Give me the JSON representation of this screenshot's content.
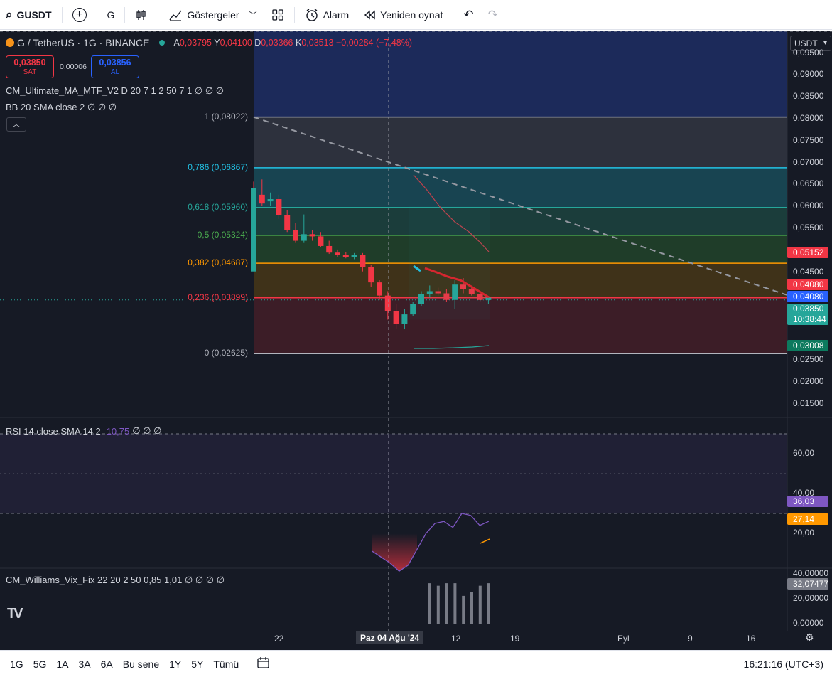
{
  "toolbar": {
    "symbol": "GUSDT",
    "add_symbol": "+",
    "interval": "G",
    "indicators_label": "Göstergeler",
    "alarm_label": "Alarm",
    "replay_label": "Yeniden oynat"
  },
  "legend": {
    "title": "G / TetherUS · 1G · BINANCE",
    "o_label": "A",
    "o_value": "0,03795",
    "h_label": "Y",
    "h_value": "0,04100",
    "l_label": "D",
    "l_value": "0,03366",
    "c_label": "K",
    "c_value": "0,03513",
    "change": "−0,00284 (−7,48%)",
    "sell_value": "0,03850",
    "sell_label": "SAT",
    "spread": "0,00006",
    "buy_value": "0,03856",
    "buy_label": "AL",
    "indicator1": "CM_Ultimate_MA_MTF_V2 D 20 7 1 2 50 7 1  ∅ ∅ ∅",
    "indicator2": "BB 20 SMA close 2  ∅ ∅ ∅",
    "rsi_label": "RSI 14 close SMA 14 2",
    "rsi_value": "10,75",
    "rsi_tail": "∅ ∅ ∅",
    "vix_label": "CM_Williams_Vix_Fix 22 20 2 50 0,85 1,01  ∅ ∅ ∅ ∅"
  },
  "price_axis": {
    "currency": "USDT",
    "ticks": [
      "0,09500",
      "0,09000",
      "0,08500",
      "0,08000",
      "0,07500",
      "0,07000",
      "0,06500",
      "0,06000",
      "0,05500",
      "0,04500",
      "0,02500",
      "0,02000",
      "0,01500"
    ],
    "tags": {
      "ma_red": "0,05152",
      "fib_level": "0,04080",
      "blue": "0,04080",
      "last": "0,03850",
      "countdown": "10:38:44",
      "low": "0,03008"
    }
  },
  "fib_levels": [
    {
      "label": "1 (0,08022)",
      "color": "#b2b5be"
    },
    {
      "label": "0,786 (0,06867)",
      "color": "#22c3e6"
    },
    {
      "label": "0,618 (0,05960)",
      "color": "#26a69a"
    },
    {
      "label": "0,5 (0,05324)",
      "color": "#4caf50"
    },
    {
      "label": "0,382 (0,04687)",
      "color": "#ff9800"
    },
    {
      "label": "0,236 (0,03899)",
      "color": "#f23645"
    },
    {
      "label": "0 (0,02625)",
      "color": "#b2b5be"
    }
  ],
  "rsi_axis": {
    "ticks": [
      "60,00",
      "40,00",
      "20,00"
    ],
    "tag_rsi": "36,03",
    "tag_sma": "27,14"
  },
  "vix_axis": {
    "ticks": [
      "40,00000",
      "20,00000",
      "0,00000"
    ],
    "tag": "32,07477"
  },
  "time_axis": {
    "labels": [
      "22",
      "Paz 04 Ağu '24",
      "12",
      "19",
      "Eyl",
      "9",
      "16"
    ]
  },
  "bottombar": {
    "ranges": [
      "1G",
      "5G",
      "1A",
      "3A",
      "6A",
      "Bu sene",
      "1Y",
      "5Y",
      "Tümü"
    ],
    "clock": "16:21:16 (UTC+3)"
  },
  "chart_data": {
    "type": "candlestick",
    "series": [
      {
        "values": [
          [
            0.064,
            0.0655,
            0.062,
            0.0625
          ],
          [
            0.0625,
            0.066,
            0.06,
            0.0605
          ],
          [
            0.061,
            0.063,
            0.06,
            0.0615
          ],
          [
            0.0615,
            0.0625,
            0.057,
            0.0578
          ],
          [
            0.0578,
            0.059,
            0.054,
            0.0545
          ],
          [
            0.0545,
            0.056,
            0.0515,
            0.052
          ],
          [
            0.052,
            0.058,
            0.0515,
            0.0535
          ],
          [
            0.0535,
            0.0545,
            0.052,
            0.053
          ],
          [
            0.053,
            0.054,
            0.0505,
            0.0508
          ],
          [
            0.0508,
            0.052,
            0.049,
            0.0493
          ],
          [
            0.0493,
            0.05,
            0.0483,
            0.0487
          ],
          [
            0.0487,
            0.0495,
            0.048,
            0.0482
          ],
          [
            0.0482,
            0.0492,
            0.0478,
            0.0488
          ],
          [
            0.0488,
            0.0492,
            0.045,
            0.046
          ],
          [
            0.046,
            0.0465,
            0.0415,
            0.0425
          ],
          [
            0.0425,
            0.043,
            0.0385,
            0.0395
          ],
          [
            0.0395,
            0.0405,
            0.034,
            0.036
          ],
          [
            0.036,
            0.0375,
            0.032,
            0.033
          ],
          [
            0.033,
            0.0365,
            0.0318,
            0.0352
          ],
          [
            0.0352,
            0.038,
            0.0348,
            0.0375
          ],
          [
            0.0375,
            0.0405,
            0.037,
            0.0398
          ],
          [
            0.0398,
            0.0418,
            0.039,
            0.0405
          ],
          [
            0.0405,
            0.0413,
            0.0395,
            0.04
          ],
          [
            0.04,
            0.041,
            0.038,
            0.0385
          ],
          [
            0.0385,
            0.043,
            0.0365,
            0.042
          ],
          [
            0.042,
            0.0435,
            0.04,
            0.041
          ],
          [
            0.041,
            0.0418,
            0.0395,
            0.0398
          ],
          [
            0.0398,
            0.0405,
            0.038,
            0.0385
          ],
          [
            0.0385,
            0.0392,
            0.0375,
            0.039
          ]
        ]
      }
    ],
    "x": [
      "Jul 19",
      "Jul 20",
      "Jul 21",
      "Jul 22",
      "Jul 23",
      "Jul 24",
      "Jul 25",
      "Jul 26",
      "Jul 27",
      "Jul 28",
      "Jul 29",
      "Jul 30",
      "Jul 31",
      "Aug 1",
      "Aug 2",
      "Aug 3",
      "Aug 4",
      "Aug 5",
      "Aug 6",
      "Aug 7",
      "Aug 8",
      "Aug 9",
      "Aug 10",
      "Aug 11",
      "Aug 12",
      "Aug 13",
      "Aug 14",
      "Aug 15",
      "Aug 16"
    ],
    "ylim": [
      0.0125,
      0.0985
    ],
    "rsi": {
      "values": [
        21,
        18,
        15,
        11,
        14,
        22,
        30,
        35,
        36,
        33,
        40,
        39,
        34,
        36
      ],
      "sma": [
        25,
        27.14
      ],
      "ylim": [
        0,
        80
      ]
    },
    "vix": {
      "values": [
        32,
        30,
        32,
        32,
        22,
        25,
        30,
        32
      ],
      "ylim": [
        0,
        45
      ]
    }
  },
  "colors": {
    "up": "#26a69a",
    "down": "#f23645",
    "blue": "#2962ff",
    "rsi": "#7e57c2",
    "orange": "#ff9800",
    "bg": "#161a25"
  }
}
